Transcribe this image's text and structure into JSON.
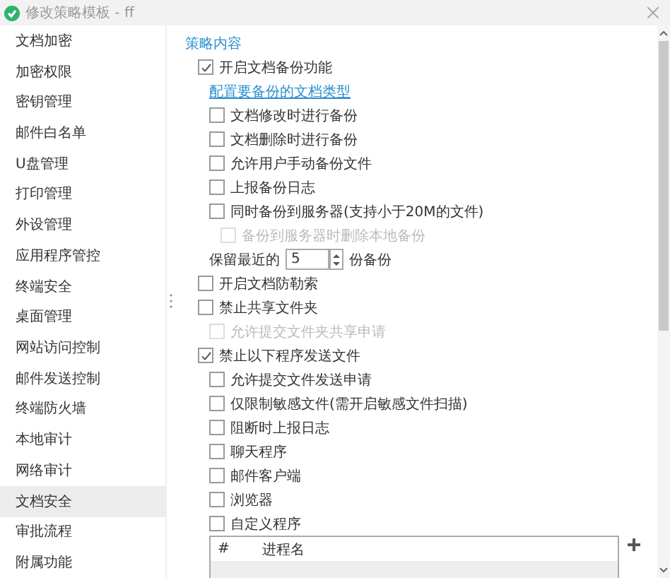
{
  "window": {
    "title": "修改策略模板 - ff"
  },
  "sidebar": {
    "items": [
      {
        "label": "文档加密",
        "selected": false
      },
      {
        "label": "加密权限",
        "selected": false
      },
      {
        "label": "密钥管理",
        "selected": false
      },
      {
        "label": "邮件白名单",
        "selected": false
      },
      {
        "label": "U盘管理",
        "selected": false
      },
      {
        "label": "打印管理",
        "selected": false
      },
      {
        "label": "外设管理",
        "selected": false
      },
      {
        "label": "应用程序管控",
        "selected": false
      },
      {
        "label": "终端安全",
        "selected": false
      },
      {
        "label": "桌面管理",
        "selected": false
      },
      {
        "label": "网站访问控制",
        "selected": false
      },
      {
        "label": "邮件发送控制",
        "selected": false
      },
      {
        "label": "终端防火墙",
        "selected": false
      },
      {
        "label": "本地审计",
        "selected": false
      },
      {
        "label": "网络审计",
        "selected": false
      },
      {
        "label": "文档安全",
        "selected": true
      },
      {
        "label": "审批流程",
        "selected": false
      },
      {
        "label": "附属功能",
        "selected": false
      }
    ]
  },
  "content": {
    "title": "策略内容",
    "options": [
      {
        "kind": "checkbox",
        "label": "开启文档备份功能",
        "checked": true,
        "disabled": false,
        "children": [
          {
            "kind": "link",
            "label": "配置要备份的文档类型"
          },
          {
            "kind": "checkbox",
            "label": "文档修改时进行备份",
            "checked": false,
            "disabled": false
          },
          {
            "kind": "checkbox",
            "label": "文档删除时进行备份",
            "checked": false,
            "disabled": false
          },
          {
            "kind": "checkbox",
            "label": "允许用户手动备份文件",
            "checked": false,
            "disabled": false
          },
          {
            "kind": "checkbox",
            "label": "上报备份日志",
            "checked": false,
            "disabled": false
          },
          {
            "kind": "checkbox",
            "label": "同时备份到服务器(支持小于20M的文件)",
            "checked": false,
            "disabled": false,
            "children": [
              {
                "kind": "checkbox",
                "label": "备份到服务器时删除本地备份",
                "checked": false,
                "disabled": true
              }
            ]
          },
          {
            "kind": "spinner",
            "label": "保留最近的",
            "value": "5",
            "unit": "份备份"
          }
        ]
      },
      {
        "kind": "checkbox",
        "label": "开启文档防勒索",
        "checked": false,
        "disabled": false
      },
      {
        "kind": "checkbox",
        "label": "禁止共享文件夹",
        "checked": false,
        "disabled": false,
        "children": [
          {
            "kind": "checkbox",
            "label": "允许提交文件夹共享申请",
            "checked": false,
            "disabled": true
          }
        ]
      },
      {
        "kind": "checkbox",
        "label": "禁止以下程序发送文件",
        "checked": true,
        "disabled": false,
        "children": [
          {
            "kind": "checkbox",
            "label": "允许提交文件发送申请",
            "checked": false,
            "disabled": false
          },
          {
            "kind": "checkbox",
            "label": "仅限制敏感文件(需开启敏感文件扫描)",
            "checked": false,
            "disabled": false
          },
          {
            "kind": "checkbox",
            "label": "阻断时上报日志",
            "checked": false,
            "disabled": false
          },
          {
            "kind": "checkbox",
            "label": "聊天程序",
            "checked": false,
            "disabled": false
          },
          {
            "kind": "checkbox",
            "label": "邮件客户端",
            "checked": false,
            "disabled": false
          },
          {
            "kind": "checkbox",
            "label": "浏览器",
            "checked": false,
            "disabled": false
          },
          {
            "kind": "checkbox",
            "label": "自定义程序",
            "checked": false,
            "disabled": false
          },
          {
            "kind": "table",
            "columns": [
              "#",
              "进程名"
            ]
          }
        ]
      }
    ]
  }
}
